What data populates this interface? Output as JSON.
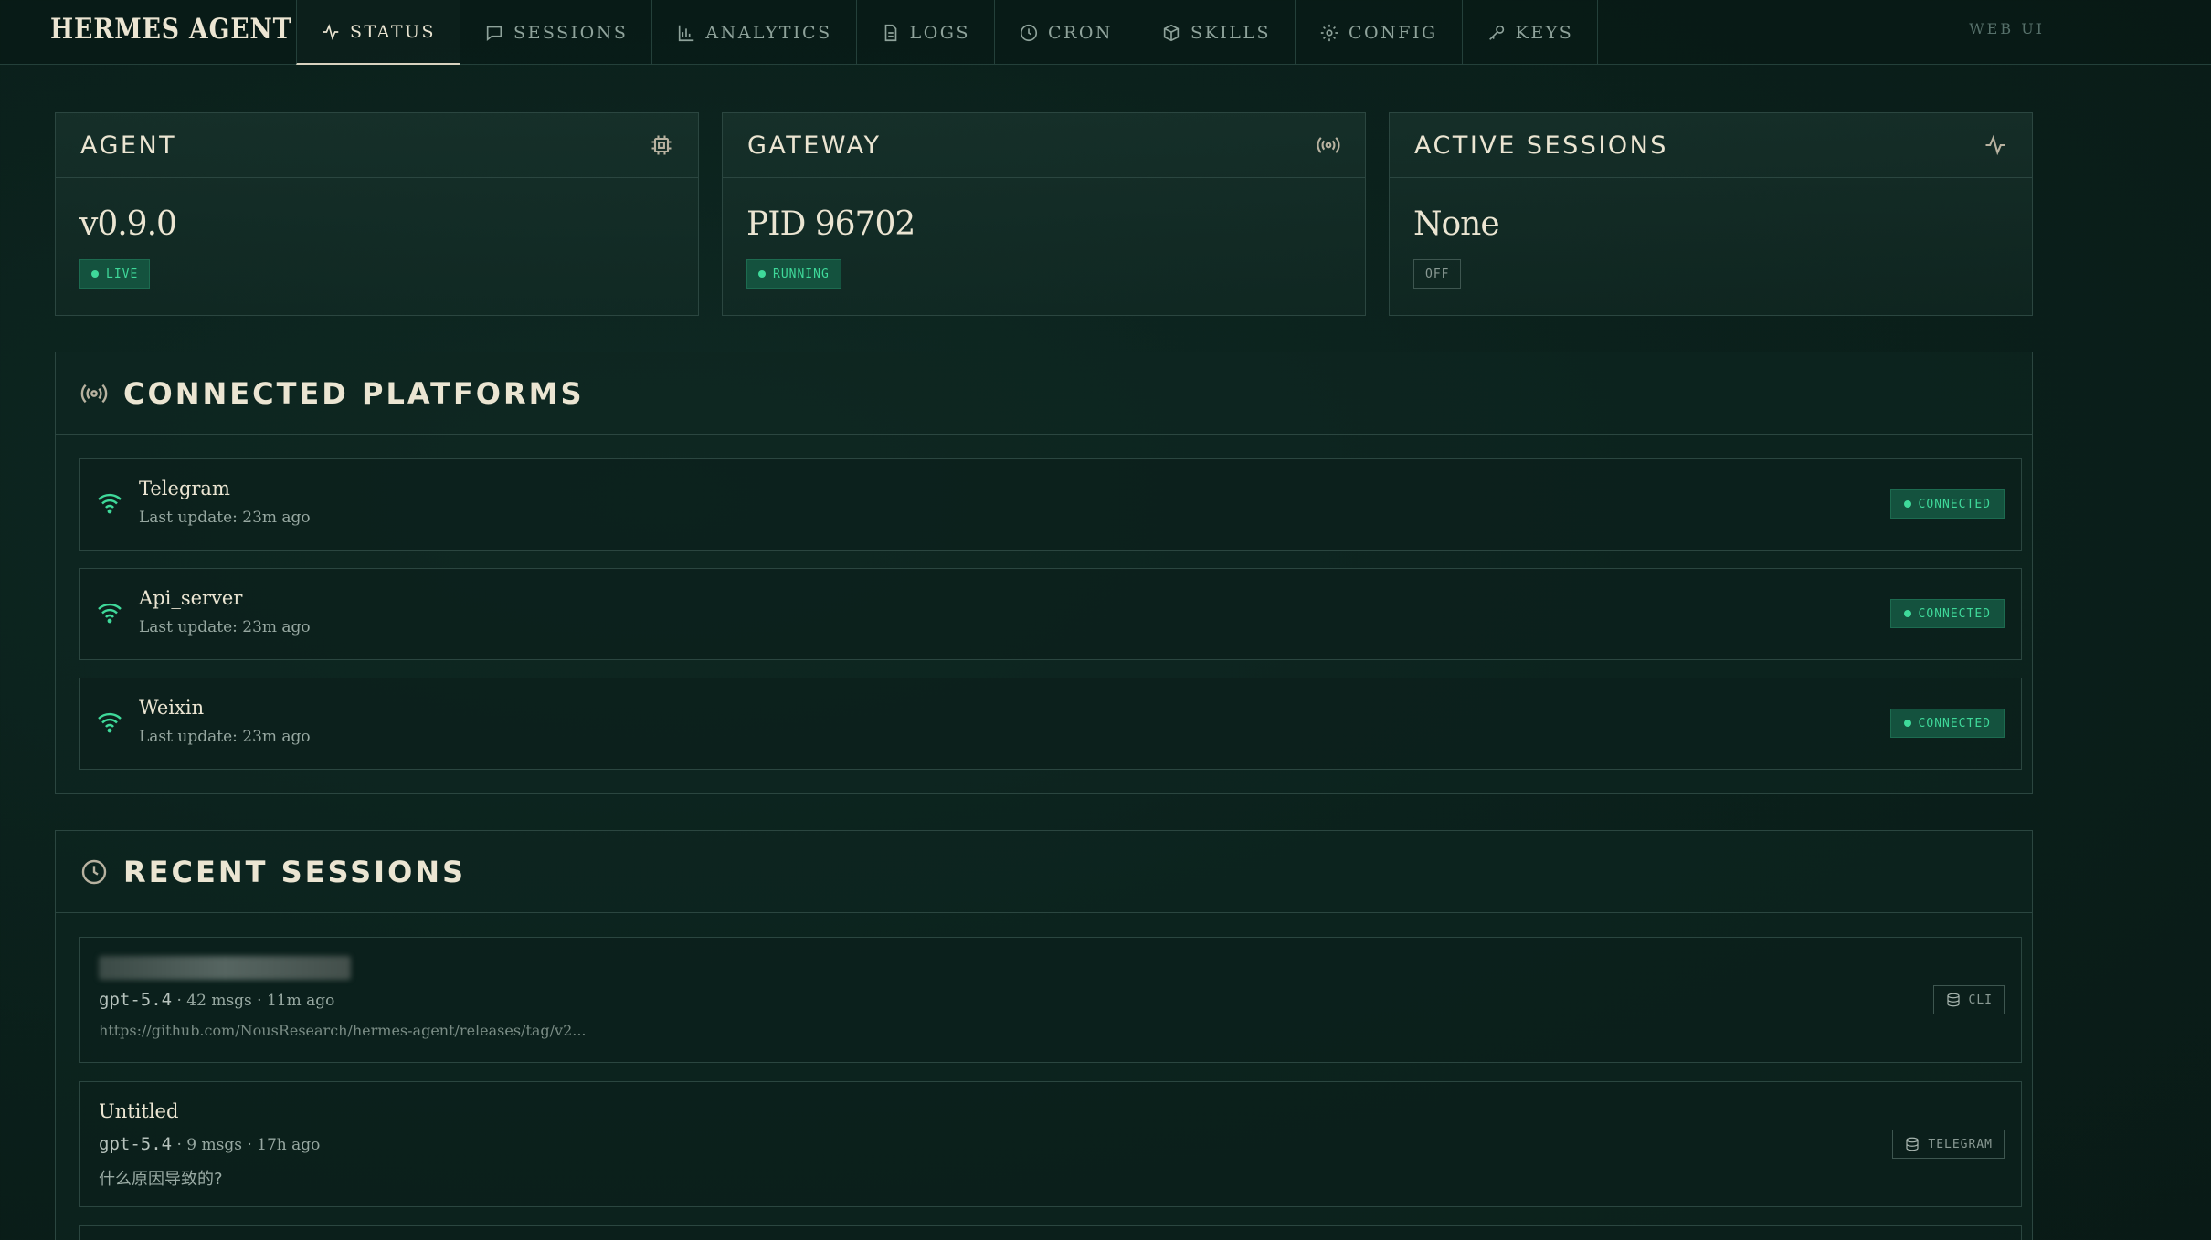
{
  "brand": "HERMES AGENT",
  "nav": {
    "tabs": [
      {
        "label": "STATUS",
        "icon": "activity-icon",
        "active": true
      },
      {
        "label": "SESSIONS",
        "icon": "chat-icon"
      },
      {
        "label": "ANALYTICS",
        "icon": "bar-chart-icon"
      },
      {
        "label": "LOGS",
        "icon": "file-icon"
      },
      {
        "label": "CRON",
        "icon": "clock-icon"
      },
      {
        "label": "SKILLS",
        "icon": "package-icon"
      },
      {
        "label": "CONFIG",
        "icon": "gear-icon"
      },
      {
        "label": "KEYS",
        "icon": "key-icon"
      }
    ],
    "right_label": "WEB UI"
  },
  "cards": {
    "agent": {
      "title": "AGENT",
      "value": "v0.9.0",
      "badge": "LIVE"
    },
    "gateway": {
      "title": "GATEWAY",
      "value": "PID 96702",
      "badge": "RUNNING"
    },
    "active_sessions": {
      "title": "ACTIVE SESSIONS",
      "value": "None",
      "badge": "OFF"
    }
  },
  "platforms": {
    "title": "CONNECTED PLATFORMS",
    "items": [
      {
        "name": "Telegram",
        "sub": "Last update: 23m ago",
        "status": "CONNECTED"
      },
      {
        "name": "Api_server",
        "sub": "Last update: 23m ago",
        "status": "CONNECTED"
      },
      {
        "name": "Weixin",
        "sub": "Last update: 23m ago",
        "status": "CONNECTED"
      }
    ]
  },
  "sessions": {
    "title": "RECENT SESSIONS",
    "items": [
      {
        "title": "",
        "model": "gpt-5.4",
        "meta": " · 42 msgs · 11m ago",
        "preview": "https://github.com/NousResearch/hermes-agent/releases/tag/v2...",
        "source": "CLI"
      },
      {
        "title": "Untitled",
        "model": "gpt-5.4",
        "meta": " · 9 msgs · 17h ago",
        "preview": "什么原因导致的?",
        "source": "TELEGRAM"
      }
    ]
  },
  "colors": {
    "accent": "#3fd99a",
    "background": "#0b211c",
    "text": "#ebe5d2"
  }
}
